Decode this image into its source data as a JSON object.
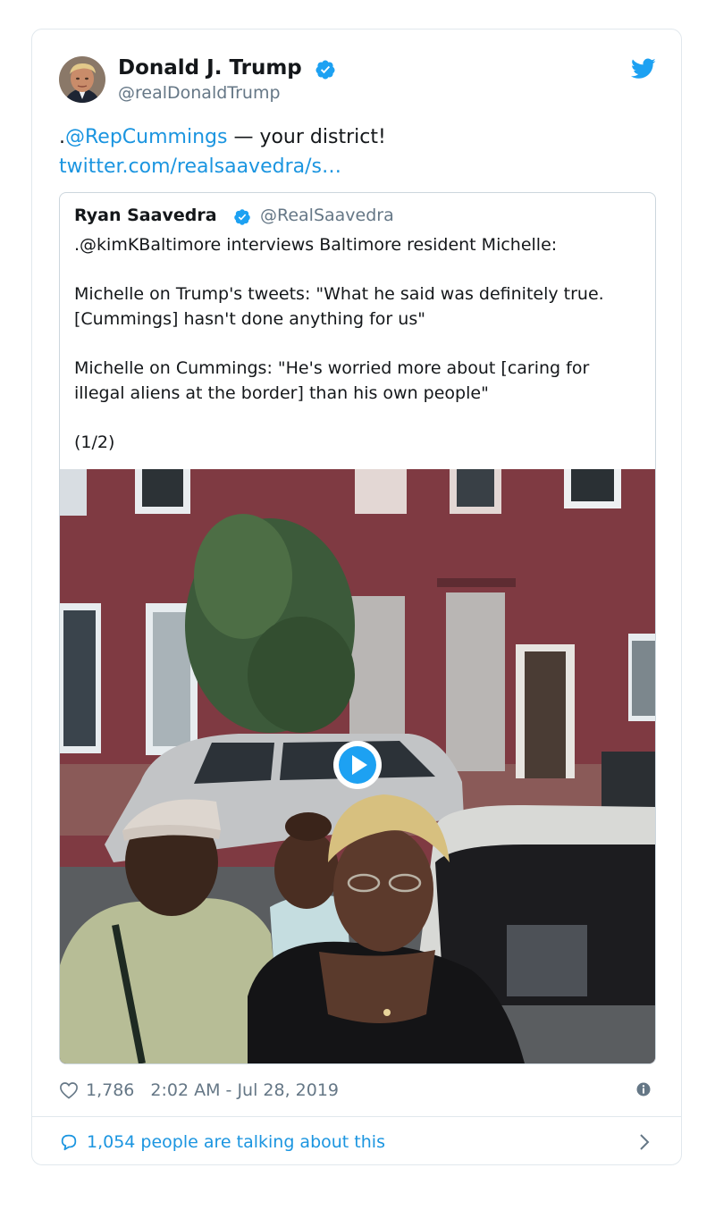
{
  "author": {
    "name": "Donald J. Trump",
    "handle": "@realDonaldTrump"
  },
  "tweet": {
    "prefix": ".",
    "mention": "@RepCummings",
    "text": " — your district!",
    "link": "twitter.com/realsaavedra/s…"
  },
  "quoted": {
    "name": "Ryan Saavedra",
    "handle": "@RealSaavedra",
    "paragraphs": [
      ".@kimKBaltimore interviews Baltimore resident Michelle:",
      "Michelle on Trump's tweets: \"What he said was definitely true. [Cummings] hasn't done anything for us\"",
      "Michelle on Cummings: \"He's worried more about [caring for illegal aliens at the border] than his own people\"",
      "(1/2)"
    ]
  },
  "footer": {
    "likes": "1,786",
    "timestamp": "2:02 AM - Jul 28, 2019",
    "talking": "1,054 people are talking about this"
  },
  "icons": {
    "verified": "verified-badge-icon",
    "twitter": "twitter-bird-icon",
    "play": "play-icon",
    "like": "heart-icon",
    "info": "info-icon",
    "reply": "speech-bubble-icon",
    "chevron": "chevron-right-icon"
  },
  "colors": {
    "link": "#1b95e0",
    "muted": "#657786",
    "border": "#e1e8ed"
  }
}
